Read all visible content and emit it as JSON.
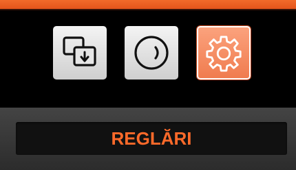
{
  "colors": {
    "accent": "#f26a2a",
    "label_text": "#ff6a2a",
    "tile_light": "#e8e8e8",
    "tile_active": "#f48a5e"
  },
  "menu": {
    "items": [
      {
        "icon": "screen-swap-icon",
        "state": "default"
      },
      {
        "icon": "dial-icon",
        "state": "default"
      },
      {
        "icon": "gear-icon",
        "state": "selected"
      }
    ]
  },
  "selected_label": "REGLĂRI"
}
